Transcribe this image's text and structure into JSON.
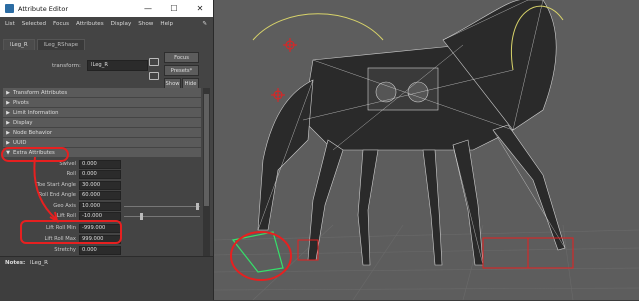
{
  "window": {
    "title": "Attribute Editor",
    "minimize": "—",
    "maximize": "☐",
    "close": "✕"
  },
  "menu": [
    "List",
    "Selected",
    "Focus",
    "Attributes",
    "Display",
    "Show",
    "Help"
  ],
  "tabs": [
    "lLeg_R",
    "lLeg_RShape"
  ],
  "transform": {
    "label": "transform:",
    "value": "lLeg_R"
  },
  "buttons": {
    "focus": "Focus",
    "presets": "Presets*",
    "show": "Show",
    "hide": "Hide"
  },
  "sections": [
    "Transform Attributes",
    "Pivots",
    "Limit Information",
    "Display",
    "Node Behavior",
    "UUID",
    "Extra Attributes"
  ],
  "attributes": [
    {
      "label": "Swivel",
      "value": "0.000"
    },
    {
      "label": "Roll",
      "value": "0.000"
    },
    {
      "label": "Toe Start Angle",
      "value": "30.000"
    },
    {
      "label": "Roll End Angle",
      "value": "60.000"
    },
    {
      "label": "Geo Axis",
      "value": "10.000"
    },
    {
      "label": "Lift Roll",
      "value": "-10.000"
    },
    {
      "label": "Lift Roll Min",
      "value": "-999.000"
    },
    {
      "label": "Lift Roll Max",
      "value": "999.000"
    },
    {
      "label": "Stretchy",
      "value": "0.000"
    }
  ],
  "notes": {
    "label": "Notes:",
    "value": "lLeg_R"
  },
  "colors": {
    "annotation": "#e62020",
    "viewport_bg": "#5d5d5d",
    "panel_bg": "#444444"
  }
}
